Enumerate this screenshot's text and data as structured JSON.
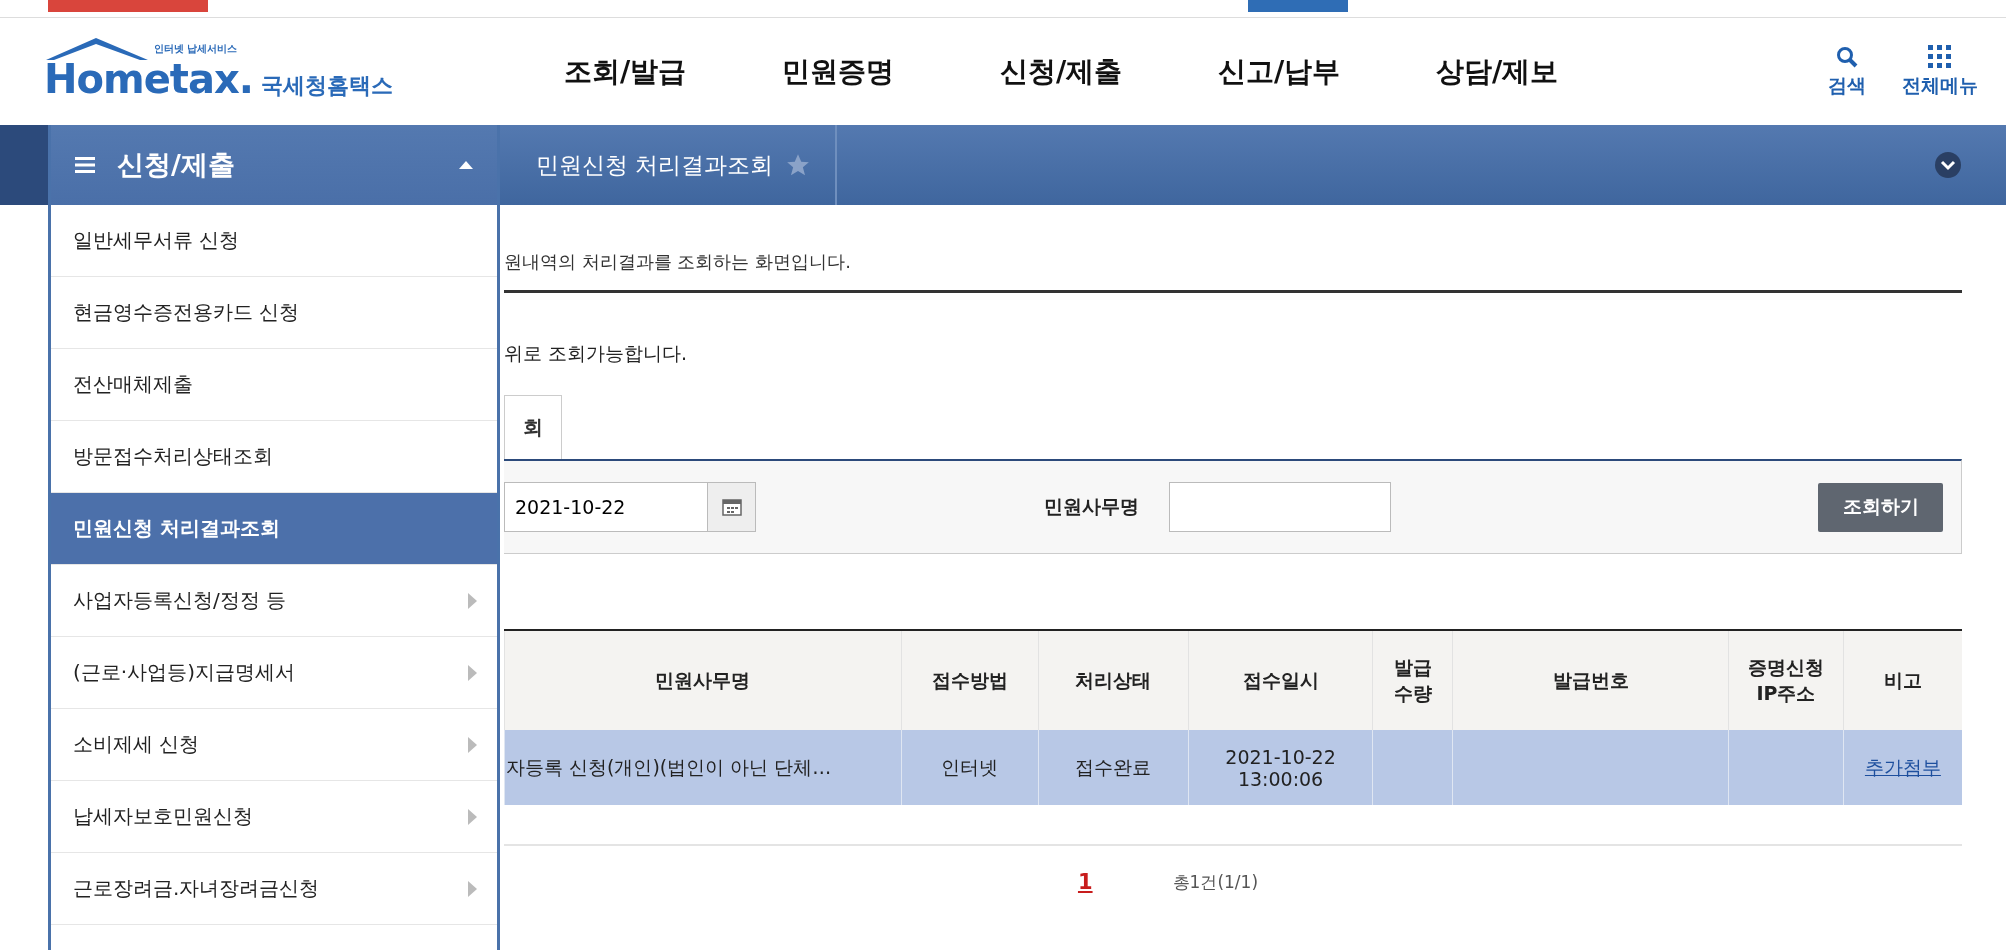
{
  "logo": {
    "tagline": "인터넷 납세서비스",
    "name": "Hometax.",
    "name_ko": "국세청홈택스"
  },
  "nav": [
    "조회/발급",
    "민원증명",
    "신청/제출",
    "신고/납부",
    "상담/제보"
  ],
  "header_actions": [
    {
      "kind": "search",
      "label": "검색"
    },
    {
      "kind": "grid",
      "label": "전체메뉴"
    }
  ],
  "menu": {
    "title": "신청/제출",
    "expanded": true,
    "items": [
      {
        "label": "일반세무서류 신청",
        "selected": false,
        "has_submenu": false
      },
      {
        "label": "현금영수증전용카드 신청",
        "selected": false,
        "has_submenu": false
      },
      {
        "label": "전산매체제출",
        "selected": false,
        "has_submenu": false
      },
      {
        "label": "방문접수처리상태조회",
        "selected": false,
        "has_submenu": false
      },
      {
        "label": "민원신청 처리결과조회",
        "selected": true,
        "has_submenu": false
      },
      {
        "label": "사업자등록신청/정정 등",
        "selected": false,
        "has_submenu": true
      },
      {
        "label": "(근로·사업등)지급명세서",
        "selected": false,
        "has_submenu": true
      },
      {
        "label": "소비제세 신청",
        "selected": false,
        "has_submenu": true
      },
      {
        "label": "납세자보호민원신청",
        "selected": false,
        "has_submenu": true
      },
      {
        "label": "근로장려금.자녀장려금신청",
        "selected": false,
        "has_submenu": true
      }
    ]
  },
  "breadcrumb": {
    "label": "민원신청 처리결과조회",
    "favorite": false
  },
  "description": "원내역의 처리결과를 조회하는 화면입니다.",
  "notice": "위로 조회가능합니다.",
  "tab": {
    "label": "회",
    "selected": true
  },
  "search": {
    "date": "2021-10-22",
    "field_label": "민원사무명",
    "button": "조회하기"
  },
  "table": {
    "columns": [
      "민원사무명",
      "접수방법",
      "처리상태",
      "접수일시",
      "발급\n수량",
      "발급번호",
      "증명신청\nIP주소",
      "비고"
    ],
    "rows": [
      {
        "selected": true,
        "cells": [
          {
            "kind": "text",
            "text": "자등록 신청(개인)(법인이 아닌 단체…"
          },
          {
            "kind": "text",
            "text": "인터넷"
          },
          {
            "kind": "text",
            "text": "접수완료"
          },
          {
            "kind": "text",
            "text": "2021-10-22\n13:00:06"
          },
          {
            "kind": "empty"
          },
          {
            "kind": "empty"
          },
          {
            "kind": "empty"
          },
          {
            "kind": "link",
            "text": "추가첨부"
          }
        ]
      }
    ]
  },
  "pagination": {
    "pages": [
      {
        "label": "1",
        "selected": true
      }
    ],
    "total": "총1건(1/1)"
  }
}
